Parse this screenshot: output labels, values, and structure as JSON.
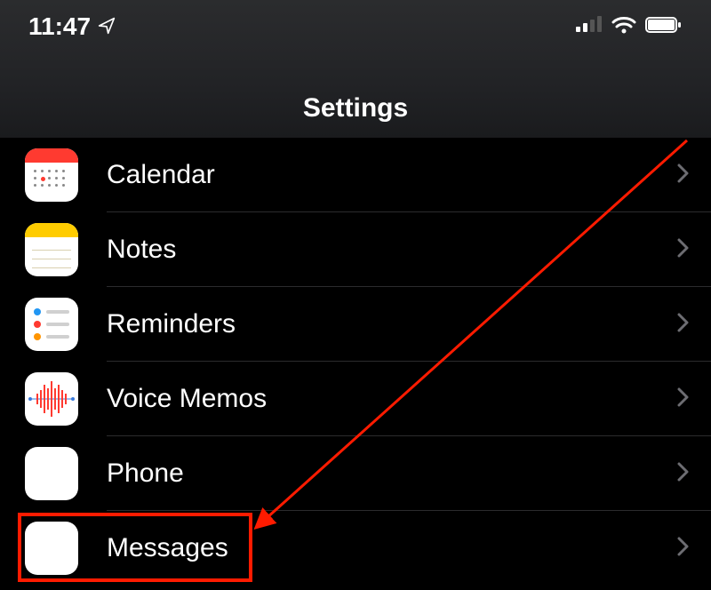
{
  "statusbar": {
    "time": "11:47",
    "location_icon": "location-arrow",
    "signal_bars": 2,
    "wifi": true,
    "battery_pct": 100
  },
  "header": {
    "title": "Settings"
  },
  "rows": [
    {
      "id": "calendar",
      "label": "Calendar",
      "icon": "calendar-icon"
    },
    {
      "id": "notes",
      "label": "Notes",
      "icon": "notes-icon"
    },
    {
      "id": "reminders",
      "label": "Reminders",
      "icon": "reminders-icon"
    },
    {
      "id": "voicememos",
      "label": "Voice Memos",
      "icon": "voice-memos-icon"
    },
    {
      "id": "phone",
      "label": "Phone",
      "icon": "phone-icon"
    },
    {
      "id": "messages",
      "label": "Messages",
      "icon": "messages-icon"
    }
  ],
  "annotation": {
    "highlighted_row": "messages",
    "arrow_color": "#ff1b00"
  }
}
